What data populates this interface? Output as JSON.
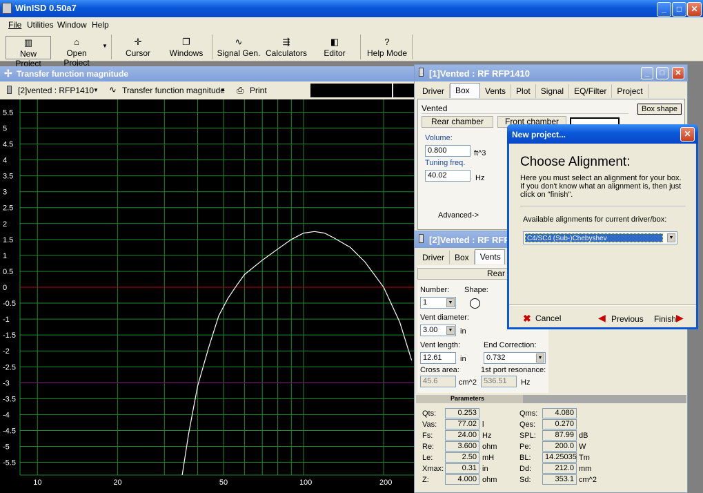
{
  "app": {
    "title": "WinISD 0.50a7"
  },
  "menu": [
    "File",
    "Utilities",
    "Window",
    "Help"
  ],
  "toolbar": [
    {
      "label": "New Project",
      "icon": "new-project-icon"
    },
    {
      "label": "Open Project",
      "icon": "open-project-icon"
    },
    {
      "label": "Cursor",
      "icon": "cursor-icon"
    },
    {
      "label": "Windows",
      "icon": "windows-icon"
    },
    {
      "label": "Signal Gen.",
      "icon": "signal-gen-icon"
    },
    {
      "label": "Calculators",
      "icon": "calculators-icon"
    },
    {
      "label": "Editor",
      "icon": "editor-icon"
    },
    {
      "label": "Help Mode",
      "icon": "help-icon"
    }
  ],
  "graph_window": {
    "title": "Transfer function magnitude",
    "project_select": "[2]vented : RFP1410",
    "plot_select": "Transfer function magnitude",
    "print_label": "Print"
  },
  "chart_data": {
    "type": "line",
    "title": "Transfer function magnitude",
    "xscale": "log",
    "xlim": [
      8.6,
      260
    ],
    "ylim": [
      -5.9,
      5.9
    ],
    "yticks": [
      5.5,
      5,
      4.5,
      4,
      3.5,
      3,
      2.5,
      2,
      1.5,
      1,
      0.5,
      0,
      -0.5,
      -1,
      -1.5,
      -2,
      -2.5,
      -3,
      -3.5,
      -4,
      -4.5,
      -5,
      -5.5
    ],
    "ytick_labels": [
      "5.5",
      "5",
      "4.5",
      "4",
      "3.5",
      "3",
      "2.5",
      "2",
      "1.5",
      "1",
      "0.5",
      "0",
      "-0.5",
      "-1",
      "-1.5",
      "-2",
      "-2.5",
      "-3",
      "-3.5",
      "-4",
      "-4.5",
      "-5",
      "-5.5"
    ],
    "xtick_labels": [
      {
        "x": 10,
        "label": "10"
      },
      {
        "x": 20,
        "label": "20"
      },
      {
        "x": 50,
        "label": "50"
      },
      {
        "x": 100,
        "label": "100"
      },
      {
        "x": 200,
        "label": "200"
      }
    ],
    "xgrid": [
      10,
      20,
      30,
      40,
      50,
      60,
      70,
      80,
      90,
      100,
      200
    ],
    "ref_lines": [
      {
        "y": 0,
        "color": "#c00000"
      },
      {
        "y": -3,
        "color": "#800080"
      }
    ],
    "grid": true,
    "colors": {
      "background": "#000000",
      "grid": "#1f8a2a",
      "curve": "#ffffff"
    },
    "series": [
      {
        "x": [
          35,
          37,
          40,
          44,
          48,
          52,
          56,
          60,
          70,
          80,
          90,
          100,
          110,
          120,
          130,
          150,
          170,
          200,
          230,
          255
        ],
        "y": [
          -5.9,
          -4.6,
          -3.1,
          -1.9,
          -0.9,
          -0.35,
          0.05,
          0.4,
          0.85,
          1.2,
          1.5,
          1.7,
          1.75,
          1.7,
          1.55,
          1.25,
          0.8,
          0.0,
          -1.1,
          -2.3
        ]
      }
    ]
  },
  "win1": {
    "title": "[1]Vented : RF RFP1410",
    "tabs": [
      "Driver",
      "Box",
      "Vents",
      "Plot",
      "Signal",
      "EQ/Filter",
      "Project"
    ],
    "box_type": "Vented",
    "box_shape_btn": "Box shape",
    "rear_chamber": "Rear chamber",
    "front_chamber": "Front chamber",
    "volume_label": "Volume:",
    "volume_value": "0.800",
    "volume_unit": "ft^3",
    "tuning_label": "Tuning freq.",
    "tuning_value": "40.02",
    "tuning_unit": "Hz",
    "advanced": "Advanced->"
  },
  "win2": {
    "title": "[2]Vented : RF RFP1410",
    "tabs": [
      "Driver",
      "Box",
      "Vents"
    ],
    "rear_chamber": "Rear chamber",
    "number_label": "Number:",
    "number_value": "1",
    "shape_label": "Shape:",
    "vent_diameter_label": "Vent diameter:",
    "vent_diameter_value": "3.00",
    "vent_diameter_unit": "in",
    "vent_length_label": "Vent length:",
    "vent_length_value": "12.61",
    "vent_length_unit": "in",
    "end_correction_label": "End Correction:",
    "end_correction_value": "0.732",
    "cross_area_label": "Cross area:",
    "cross_area_value": "45.6",
    "cross_area_unit": "cm^2",
    "port_res_label": "1st port resonance:",
    "port_res_value": "536.51",
    "port_res_unit": "Hz"
  },
  "parameters": {
    "title": "Parameters",
    "left": [
      {
        "name": "Qts:",
        "value": "0.253",
        "unit": ""
      },
      {
        "name": "Vas:",
        "value": "77.02",
        "unit": "l"
      },
      {
        "name": "Fs:",
        "value": "24.00",
        "unit": "Hz"
      },
      {
        "name": "Re:",
        "value": "3.600",
        "unit": "ohm"
      },
      {
        "name": "Le:",
        "value": "2.50",
        "unit": "mH"
      },
      {
        "name": "Xmax:",
        "value": "0.31",
        "unit": "in"
      },
      {
        "name": "Z:",
        "value": "4.000",
        "unit": "ohm"
      }
    ],
    "right": [
      {
        "name": "Qms:",
        "value": "4.080",
        "unit": ""
      },
      {
        "name": "Qes:",
        "value": "0.270",
        "unit": ""
      },
      {
        "name": "SPL:",
        "value": "87.99",
        "unit": "dB"
      },
      {
        "name": "Pe:",
        "value": "200.0",
        "unit": "W"
      },
      {
        "name": "BL:",
        "value": "14.25035",
        "unit": "Tm"
      },
      {
        "name": "Dd:",
        "value": "212.0",
        "unit": "mm"
      },
      {
        "name": "Sd:",
        "value": "353.1",
        "unit": "cm^2"
      }
    ]
  },
  "dialog": {
    "title": "New project...",
    "heading": "Choose Alignment:",
    "description": "Here you must select an alignment for your box. If you don't know what an alignment is, then just click on \"finish\".",
    "available_label": "Available alignments for current driver/box:",
    "selected": "C4/SC4 (Sub-)Chebyshev",
    "cancel": "Cancel",
    "previous": "Previous",
    "finish": "Finish"
  }
}
